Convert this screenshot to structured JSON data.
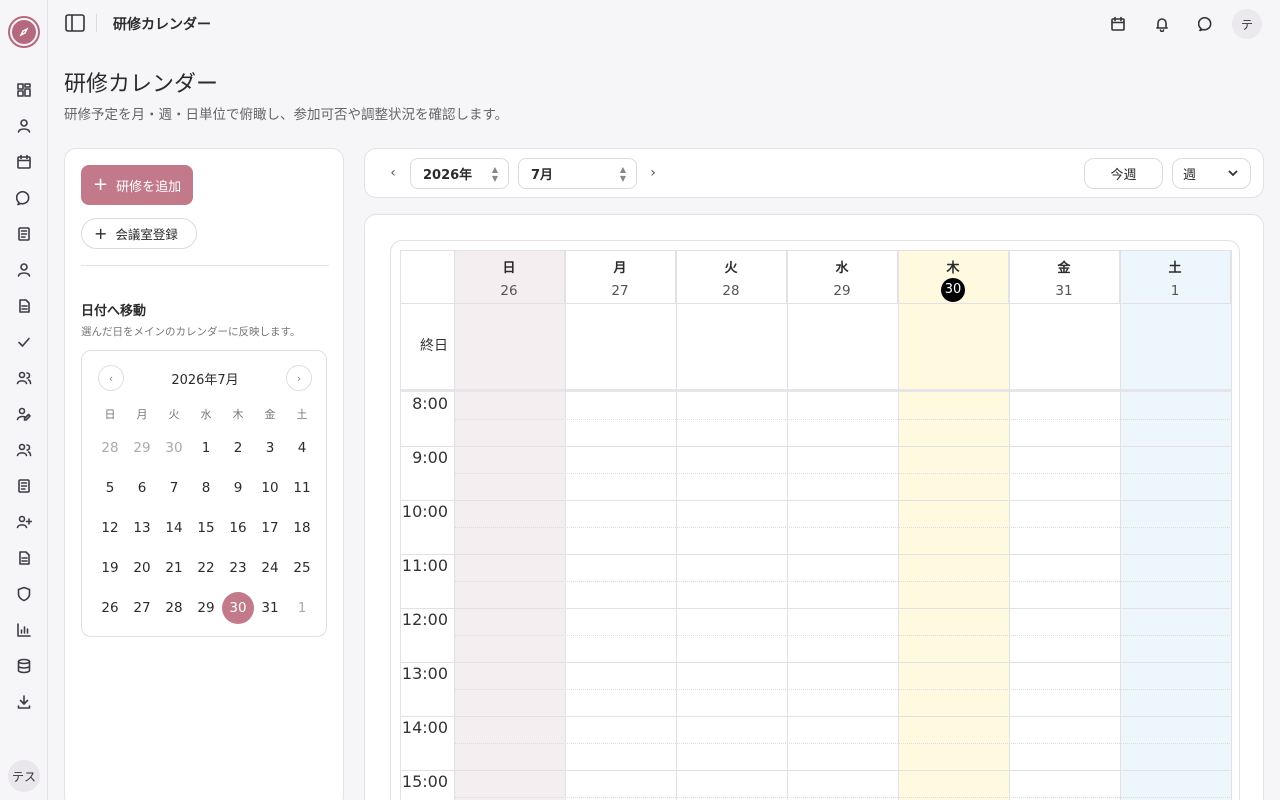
{
  "app": {
    "logo_icon": "compass-icon",
    "user_initial": "テ",
    "rail_user_label": "テス"
  },
  "topbar": {
    "title": "研修カレンダー"
  },
  "page": {
    "title": "研修カレンダー",
    "subtitle": "研修予定を月・週・日単位で俯瞰し、参加可否や調整状況を確認します。"
  },
  "left_panel": {
    "add_training_label": "研修を追加",
    "register_room_label": "会議室登録",
    "jump_title": "日付へ移動",
    "jump_subtitle": "選んだ日をメインのカレンダーに反映します。",
    "mini_calendar": {
      "title": "2026年7月",
      "weekdays": [
        "日",
        "月",
        "火",
        "水",
        "木",
        "金",
        "土"
      ],
      "weeks": [
        [
          {
            "d": "28",
            "m": true
          },
          {
            "d": "29",
            "m": true
          },
          {
            "d": "30",
            "m": true
          },
          {
            "d": "1"
          },
          {
            "d": "2"
          },
          {
            "d": "3"
          },
          {
            "d": "4"
          }
        ],
        [
          {
            "d": "5"
          },
          {
            "d": "6"
          },
          {
            "d": "7"
          },
          {
            "d": "8"
          },
          {
            "d": "9"
          },
          {
            "d": "10"
          },
          {
            "d": "11"
          }
        ],
        [
          {
            "d": "12"
          },
          {
            "d": "13"
          },
          {
            "d": "14"
          },
          {
            "d": "15"
          },
          {
            "d": "16"
          },
          {
            "d": "17"
          },
          {
            "d": "18"
          }
        ],
        [
          {
            "d": "19"
          },
          {
            "d": "20"
          },
          {
            "d": "21"
          },
          {
            "d": "22"
          },
          {
            "d": "23"
          },
          {
            "d": "24"
          },
          {
            "d": "25"
          }
        ],
        [
          {
            "d": "26"
          },
          {
            "d": "27"
          },
          {
            "d": "28"
          },
          {
            "d": "29"
          },
          {
            "d": "30",
            "sel": true
          },
          {
            "d": "31"
          },
          {
            "d": "1",
            "m": true
          }
        ]
      ]
    }
  },
  "toolbar": {
    "year_value": "2026年",
    "month_value": "7月",
    "this_week_label": "今週",
    "view_value": "週"
  },
  "calendar": {
    "allday_label": "終日",
    "columns": [
      {
        "weekday": "日",
        "date": "26",
        "tint": "#f5eef1"
      },
      {
        "weekday": "月",
        "date": "27",
        "tint": "#ffffff"
      },
      {
        "weekday": "火",
        "date": "28",
        "tint": "#ffffff"
      },
      {
        "weekday": "水",
        "date": "29",
        "tint": "#ffffff"
      },
      {
        "weekday": "木",
        "date": "30",
        "tint": "#fff9e0",
        "today": true
      },
      {
        "weekday": "金",
        "date": "31",
        "tint": "#ffffff"
      },
      {
        "weekday": "土",
        "date": "1",
        "tint": "#eef6fd"
      }
    ],
    "hours": [
      "8:00",
      "9:00",
      "10:00",
      "11:00",
      "12:00",
      "13:00",
      "14:00",
      "15:00"
    ]
  },
  "colors": {
    "accent": "#c27a8b",
    "today_bg": "#000000",
    "sunday_tint": "#f5eef1",
    "saturday_tint": "#eef6fd",
    "today_tint": "#fff9e0"
  }
}
